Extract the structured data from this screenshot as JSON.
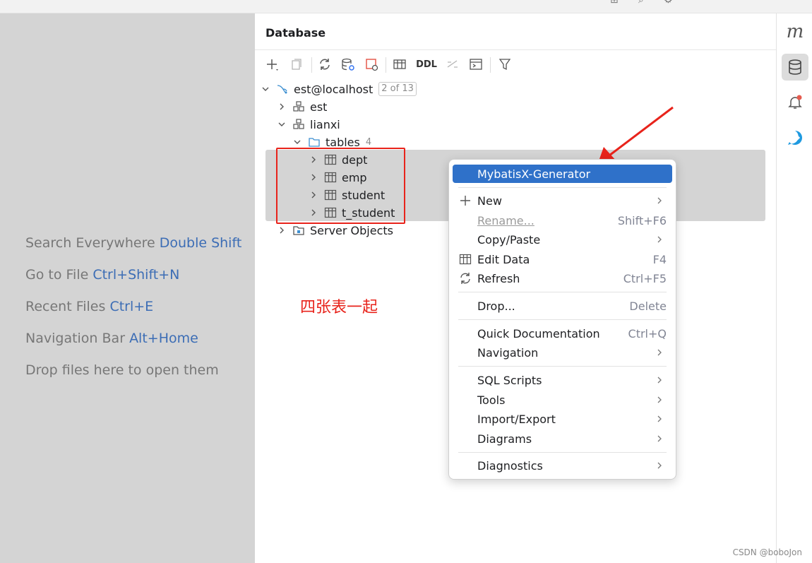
{
  "editor_hints": [
    {
      "text": "Search Everywhere",
      "shortcut": "Double Shift"
    },
    {
      "text": "Go to File",
      "shortcut": "Ctrl+Shift+N"
    },
    {
      "text": "Recent Files",
      "shortcut": "Ctrl+E"
    },
    {
      "text": "Navigation Bar",
      "shortcut": "Alt+Home"
    },
    {
      "text": "Drop files here to open them",
      "shortcut": ""
    }
  ],
  "panel": {
    "title": "Database",
    "toolbar": {
      "ddl_label": "DDL"
    }
  },
  "tree": {
    "datasource": {
      "label": "est@localhost",
      "badge": "2 of 13"
    },
    "schema_est": "est",
    "schema_lianxi": "lianxi",
    "tables_folder": {
      "label": "tables",
      "count": "4"
    },
    "tables": [
      "dept",
      "emp",
      "student",
      "t_student"
    ],
    "server_objects": "Server Objects"
  },
  "annotation": "四张表一起",
  "context_menu": {
    "items": [
      {
        "label": "MybatisX-Generator",
        "shortcut": ""
      },
      {
        "label": "New",
        "shortcut": ""
      },
      {
        "label": "Rename...",
        "shortcut": "Shift+F6"
      },
      {
        "label": "Copy/Paste",
        "shortcut": ""
      },
      {
        "label": "Edit Data",
        "shortcut": "F4"
      },
      {
        "label": "Refresh",
        "shortcut": "Ctrl+F5"
      },
      {
        "label": "Drop...",
        "shortcut": "Delete"
      },
      {
        "label": "Quick Documentation",
        "shortcut": "Ctrl+Q"
      },
      {
        "label": "Navigation",
        "shortcut": ""
      },
      {
        "label": "SQL Scripts",
        "shortcut": ""
      },
      {
        "label": "Tools",
        "shortcut": ""
      },
      {
        "label": "Import/Export",
        "shortcut": ""
      },
      {
        "label": "Diagrams",
        "shortcut": ""
      },
      {
        "label": "Diagnostics",
        "shortcut": ""
      }
    ]
  },
  "right_strip": {
    "logo": "m"
  },
  "watermark": "CSDN @boboJon",
  "colors": {
    "accent": "#2f71c9",
    "annotation_red": "#e8231b",
    "shortcut_blue": "#3c6db5",
    "notification_dot": "#e55b4f"
  },
  "icons": [
    "search-icon",
    "gear-icon",
    "add-icon",
    "copy-icon",
    "refresh-icon",
    "datasource-properties-icon",
    "jump-to-console-icon",
    "table-icon",
    "diff-icon",
    "console-icon",
    "filter-icon",
    "mysql-icon",
    "schema-icon",
    "folder-icon",
    "database-icon",
    "bell-icon",
    "ai-assistant-icon"
  ]
}
